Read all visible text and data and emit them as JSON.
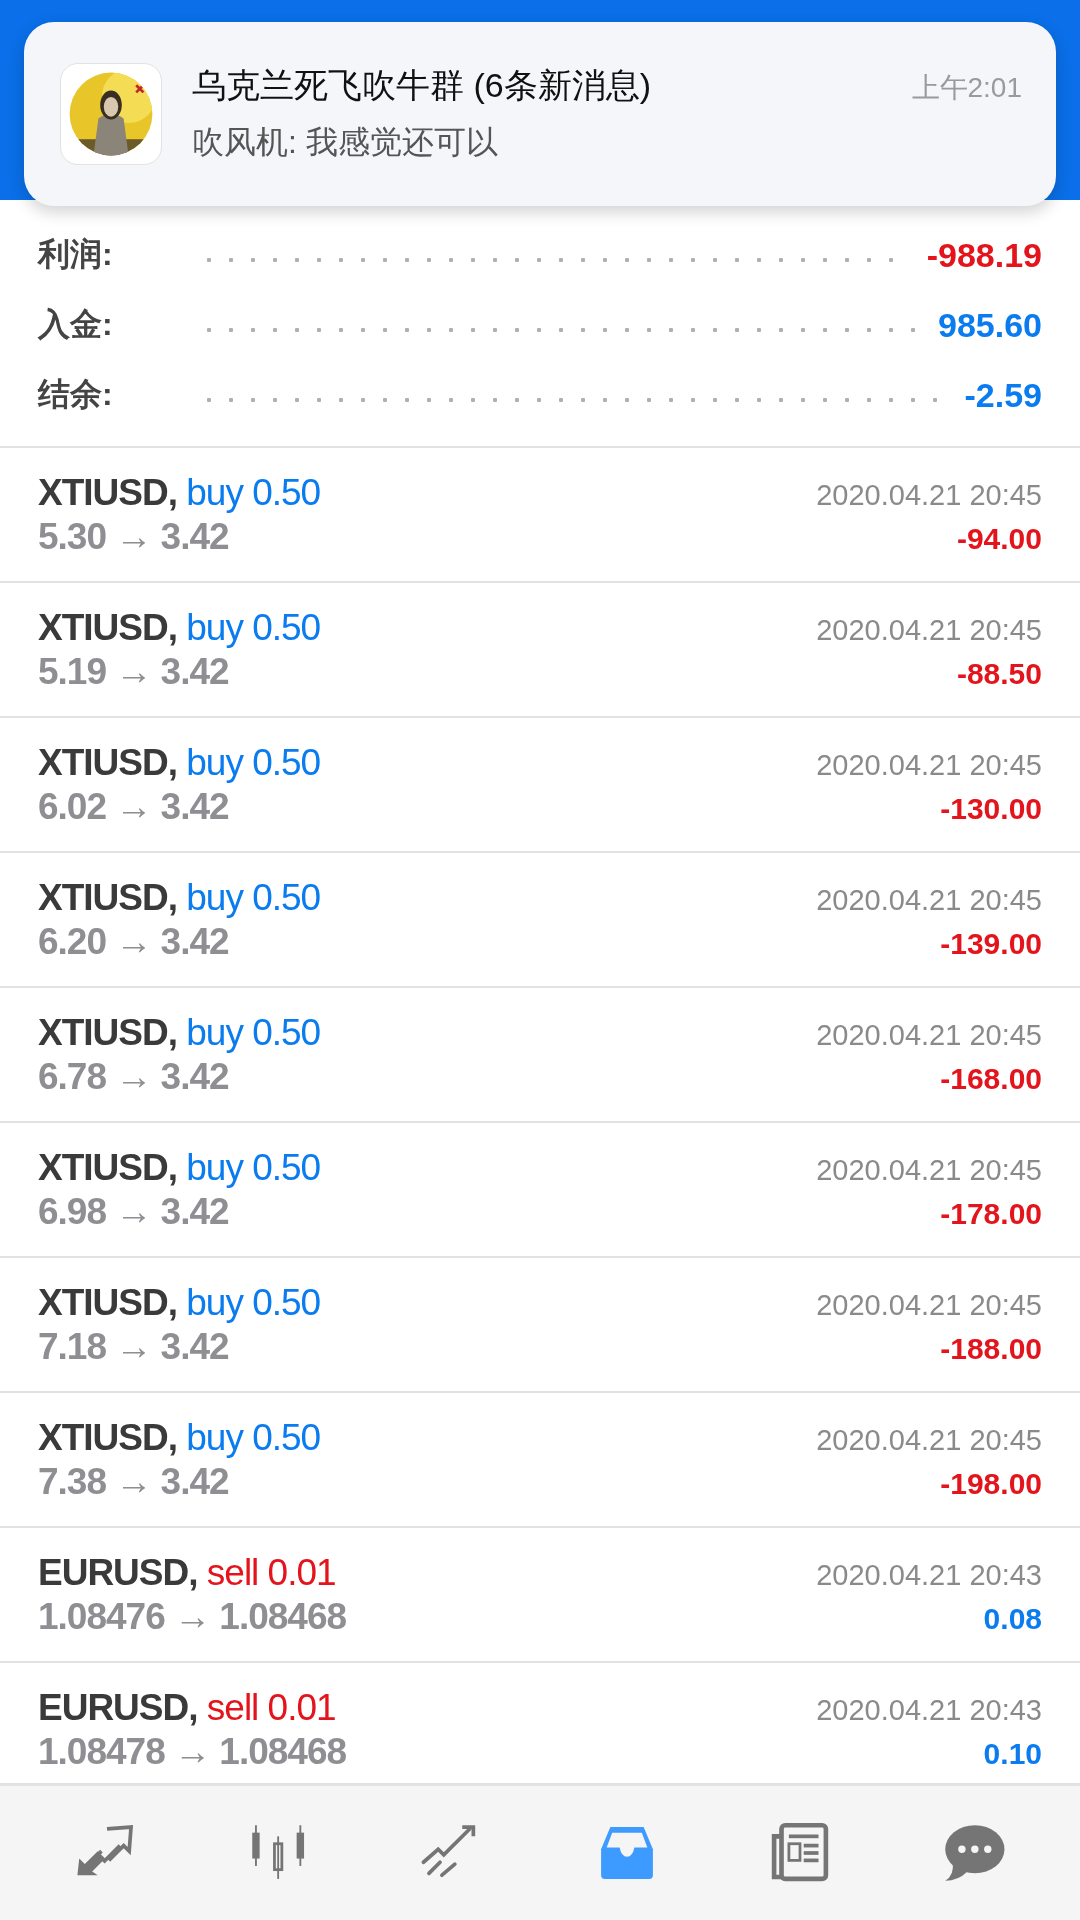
{
  "notification": {
    "title": "乌克兰死飞吹牛群 (6条新消息)",
    "message": "吹风机: 我感觉还可以",
    "time": "上午2:01"
  },
  "summary": [
    {
      "label": "利润:",
      "value": "-988.19",
      "color": "#e3141b"
    },
    {
      "label": "入金:",
      "value": "985.60",
      "color": "#0a7cf0"
    },
    {
      "label": "结余:",
      "value": "-2.59",
      "color": "#0a7cf0"
    }
  ],
  "trades": [
    {
      "symbol": "XTIUSD,",
      "kind": "buy",
      "side": "buy 0.50",
      "prices": "5.30 → 3.42",
      "time": "2020.04.21 20:45",
      "profit": "-94.00",
      "color": "#e3141b"
    },
    {
      "symbol": "XTIUSD,",
      "kind": "buy",
      "side": "buy 0.50",
      "prices": "5.19 → 3.42",
      "time": "2020.04.21 20:45",
      "profit": "-88.50",
      "color": "#e3141b"
    },
    {
      "symbol": "XTIUSD,",
      "kind": "buy",
      "side": "buy 0.50",
      "prices": "6.02 → 3.42",
      "time": "2020.04.21 20:45",
      "profit": "-130.00",
      "color": "#e3141b"
    },
    {
      "symbol": "XTIUSD,",
      "kind": "buy",
      "side": "buy 0.50",
      "prices": "6.20 → 3.42",
      "time": "2020.04.21 20:45",
      "profit": "-139.00",
      "color": "#e3141b"
    },
    {
      "symbol": "XTIUSD,",
      "kind": "buy",
      "side": "buy 0.50",
      "prices": "6.78 → 3.42",
      "time": "2020.04.21 20:45",
      "profit": "-168.00",
      "color": "#e3141b"
    },
    {
      "symbol": "XTIUSD,",
      "kind": "buy",
      "side": "buy 0.50",
      "prices": "6.98 → 3.42",
      "time": "2020.04.21 20:45",
      "profit": "-178.00",
      "color": "#e3141b"
    },
    {
      "symbol": "XTIUSD,",
      "kind": "buy",
      "side": "buy 0.50",
      "prices": "7.18 → 3.42",
      "time": "2020.04.21 20:45",
      "profit": "-188.00",
      "color": "#e3141b"
    },
    {
      "symbol": "XTIUSD,",
      "kind": "buy",
      "side": "buy 0.50",
      "prices": "7.38 → 3.42",
      "time": "2020.04.21 20:45",
      "profit": "-198.00",
      "color": "#e3141b"
    },
    {
      "symbol": "EURUSD,",
      "kind": "sell",
      "side": "sell 0.01",
      "prices": "1.08476 → 1.08468",
      "time": "2020.04.21 20:43",
      "profit": "0.08",
      "color": "#0a7cf0"
    },
    {
      "symbol": "EURUSD,",
      "kind": "sell",
      "side": "sell 0.01",
      "prices": "1.08478 → 1.08468",
      "time": "2020.04.21 20:43",
      "profit": "0.10",
      "color": "#0a7cf0"
    }
  ],
  "nav": [
    {
      "kind": "trade",
      "selected": false
    },
    {
      "kind": "quotes",
      "selected": false
    },
    {
      "kind": "chart",
      "selected": false
    },
    {
      "kind": "history",
      "selected": true
    },
    {
      "kind": "news",
      "selected": false
    },
    {
      "kind": "chat",
      "selected": false
    }
  ]
}
